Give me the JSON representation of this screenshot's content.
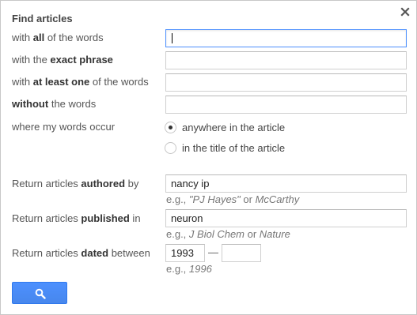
{
  "dialog": {
    "title": "Find articles",
    "close_icon": "close-icon"
  },
  "words": {
    "all": {
      "pre": "with ",
      "bold": "all",
      "post": " of the words",
      "value": ""
    },
    "exact": {
      "pre": "with the ",
      "bold": "exact phrase",
      "post": "",
      "value": ""
    },
    "atleast": {
      "pre": "with ",
      "bold": "at least one",
      "post": " of the words",
      "value": ""
    },
    "without": {
      "pre": "",
      "bold": "without",
      "post": " the words",
      "value": ""
    }
  },
  "occur": {
    "label": "where my words occur",
    "options": [
      {
        "label": "anywhere in the article",
        "checked": true
      },
      {
        "label": "in the title of the article",
        "checked": false
      }
    ]
  },
  "authored": {
    "pre": "Return articles ",
    "bold": "authored",
    "post": " by",
    "value": "nancy ip",
    "hint_pre": "e.g., ",
    "hint_ex1": "\"PJ Hayes\"",
    "hint_or": " or ",
    "hint_ex2": "McCarthy"
  },
  "published": {
    "pre": "Return articles ",
    "bold": "published",
    "post": " in",
    "value": "neuron",
    "hint_pre": "e.g., ",
    "hint_ex1": "J Biol Chem",
    "hint_or": " or ",
    "hint_ex2": "Nature"
  },
  "dated": {
    "pre": "Return articles ",
    "bold": "dated",
    "post": " between",
    "from": "1993",
    "to": "",
    "dash": "—",
    "hint_pre": "e.g., ",
    "hint_ex": "1996"
  },
  "search_button": {
    "icon": "search-icon",
    "color": "#4d90fe"
  }
}
